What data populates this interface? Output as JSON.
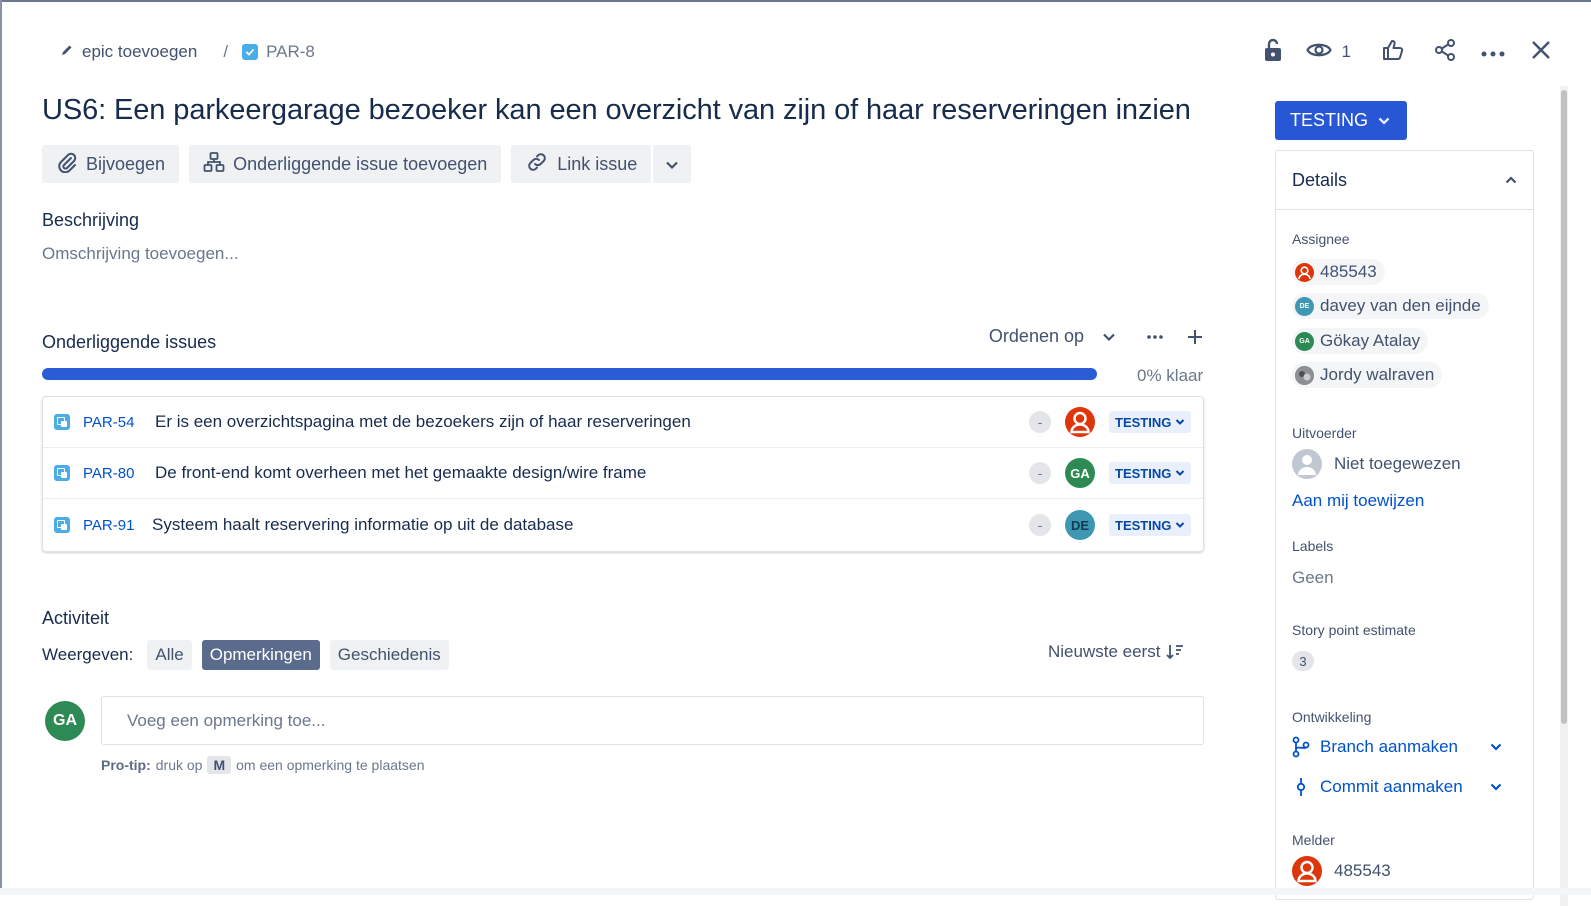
{
  "breadcrumb": {
    "epic": "epic toevoegen",
    "separator": "/",
    "issue_key": "PAR-8"
  },
  "top_actions": {
    "watchers_count": "1"
  },
  "issue": {
    "title": "US6: Een parkeergarage bezoeker kan een overzicht van zijn of haar reserveringen inzien"
  },
  "buttons": {
    "attach": "Bijvoegen",
    "add_child": "Onderliggende issue toevoegen",
    "link": "Link issue"
  },
  "description": {
    "label": "Beschrijving",
    "placeholder": "Omschrijving toevoegen..."
  },
  "child_issues": {
    "label": "Onderliggende issues",
    "order_by": "Ordenen op",
    "progress_percent": 0,
    "progress_text": "0% klaar",
    "items": [
      {
        "key": "PAR-54",
        "summary": "Er is een overzichtspagina met de bezoekers zijn of haar reserveringen",
        "priority": "-",
        "assignee_initials": "",
        "status": "TESTING"
      },
      {
        "key": "PAR-80",
        "summary": "De front-end komt overheen met het gemaakte design/wire frame",
        "priority": "-",
        "assignee_initials": "GA",
        "status": "TESTING"
      },
      {
        "key": "PAR-91",
        "summary": "Systeem haalt reservering informatie op uit de database",
        "priority": "-",
        "assignee_initials": "DE",
        "status": "TESTING"
      }
    ]
  },
  "activity": {
    "label": "Activiteit",
    "show_label": "Weergeven:",
    "filters": [
      "Alle",
      "Opmerkingen",
      "Geschiedenis"
    ],
    "active_filter": "Opmerkingen",
    "sort": "Nieuwste eerst",
    "user_initials": "GA",
    "comment_placeholder": "Voeg een opmerking toe...",
    "protip_bold": "Pro-tip:",
    "protip_pre": "druk op",
    "protip_key": "M",
    "protip_post": "om een opmerking te plaatsen"
  },
  "sidebar": {
    "status": "TESTING",
    "details_label": "Details",
    "assignee_label": "Assignee",
    "assignees": [
      {
        "name": "485543",
        "initials": ""
      },
      {
        "name": "davey van den eijnde",
        "initials": "DE"
      },
      {
        "name": "Gökay Atalay",
        "initials": "GA"
      },
      {
        "name": "Jordy walraven",
        "initials": ""
      }
    ],
    "uitvoerder_label": "Uitvoerder",
    "uitvoerder_value": "Niet toegewezen",
    "assign_to_me": "Aan mij toewijzen",
    "labels_label": "Labels",
    "labels_value": "Geen",
    "story_points_label": "Story point estimate",
    "story_points_value": "3",
    "development_label": "Ontwikkeling",
    "create_branch": "Branch aanmaken",
    "create_commit": "Commit aanmaken",
    "reporter_label": "Melder",
    "reporter_value": "485543"
  },
  "colors": {
    "accent": "#2857d6",
    "link": "#0052cc",
    "status_bg": "#e9f0fc",
    "avatar_green": "#2d8a55",
    "avatar_teal": "#3e98b4",
    "avatar_red": "#de350b"
  }
}
